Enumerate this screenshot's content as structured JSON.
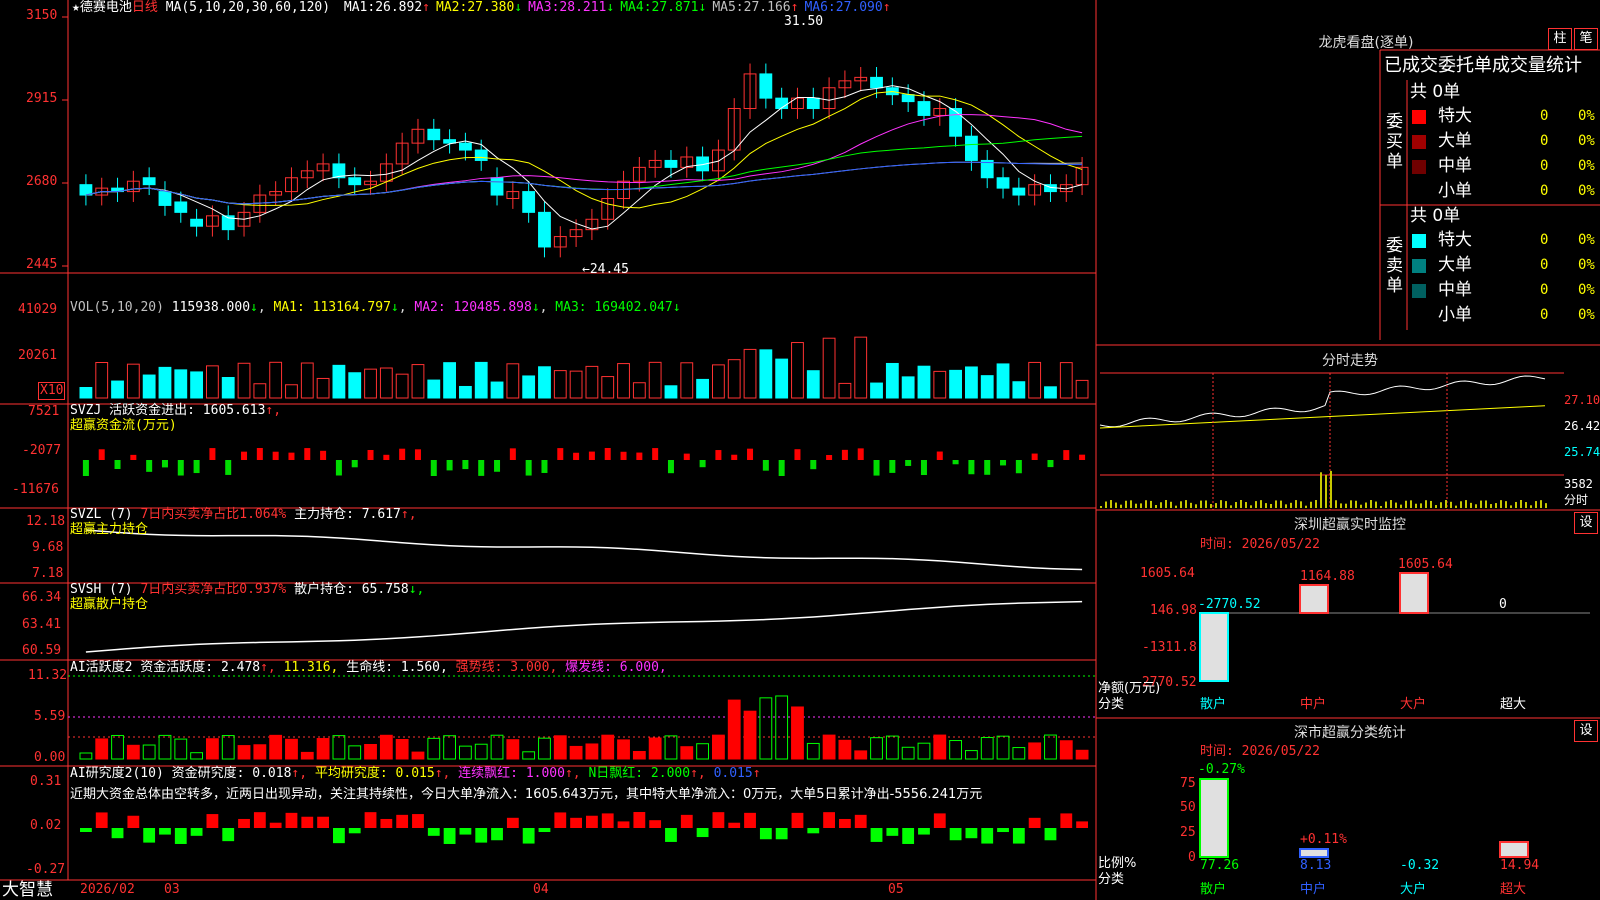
{
  "header": {
    "star": "★",
    "stock": "德赛电池",
    "period": "日线",
    "ma_label": "MA(5,10,20,30,60,120)",
    "ma": [
      {
        "name": "MA1:",
        "value": "26.892",
        "arrow": "↑",
        "color": "#ffffff"
      },
      {
        "name": "MA2:",
        "value": "27.380",
        "arrow": "↓",
        "color": "#ffff00"
      },
      {
        "name": "MA3:",
        "value": "28.211",
        "arrow": "↓",
        "color": "#ff33ff"
      },
      {
        "name": "MA4:",
        "value": "27.871",
        "arrow": "↓",
        "color": "#00ff00"
      },
      {
        "name": "MA5:",
        "value": "27.166",
        "arrow": "↑",
        "color": "#c0c0c0"
      },
      {
        "name": "MA6:",
        "value": "27.090",
        "arrow": "↑",
        "color": "#3060ff"
      }
    ]
  },
  "price_axis": [
    "3150",
    "2915",
    "2680",
    "2445"
  ],
  "annotations": {
    "high": "31.50",
    "low": "←24.45"
  },
  "vol": {
    "label": "VOL(5,10,20)",
    "value": "115938.000",
    "arrow": "↓",
    "ma1": "MA1: 113164.797",
    "ma1_arrow": "↓",
    "ma2": "MA2: 120485.898",
    "ma2_arrow": "↓",
    "ma3": "MA3: 169402.047",
    "ma3_arrow": "↓",
    "axis": [
      "41029",
      "20261"
    ],
    "unit": "X10"
  },
  "svzj": {
    "line1": "SVZJ  活跃资金进出: 1605.613",
    "arrow": "↑,",
    "line2": "超赢资金流(万元)",
    "axis": [
      "7521",
      "-2077",
      "-11676"
    ]
  },
  "svzl": {
    "label": "SVZL (7)",
    "part1": "7日内买卖净占比1.064%",
    "part2": "主力持仓: 7.617",
    "arrow": "↑,",
    "line2": "超赢主力持仓",
    "axis": [
      "12.18",
      "9.68",
      "7.18"
    ]
  },
  "svsh": {
    "label": "SVSH (7)",
    "part1": "7日内买卖净占比0.937%",
    "part2": "散户持仓: 65.758",
    "arrow": "↓,",
    "line2": "超赢散户持仓",
    "axis": [
      "66.34",
      "63.41",
      "60.59"
    ]
  },
  "ai": {
    "label": "AI活跃度2 资金活跃度: 2.478",
    "a1": "↑,",
    "v2": "11.316,",
    "v3": "生命线: 1.560,",
    "v4": "强势线: 3.000,",
    "v5": "爆发线: 6.000,",
    "axis": [
      "11.32",
      "5.59",
      "0.00"
    ]
  },
  "ai_research": {
    "label": "AI研究度2(10) 资金研究度: 0.018",
    "a1": "↑,",
    "v2": "平均研究度: 0.015",
    "a2": "↑,",
    "v3": "连续飘红: 1.000",
    "a3": "↑,",
    "v4": "N日飘红: 2.000",
    "a4": "↑,",
    "v5": "0.015",
    "a5": "↑",
    "comment": "近期大资金总体由空转多，近两日出现异动，关注其持续性，今日大单净流入：1605.643万元，其中特大单净流入：0万元，大单5日累计净出-5556.241万元",
    "axis": [
      "0.31",
      "0.02",
      "-0.27"
    ]
  },
  "dates": [
    "2026/02",
    "03",
    "04",
    "05"
  ],
  "brand": "大智慧",
  "right": {
    "tabs": [
      "柱",
      "笔"
    ],
    "title": "龙虎看盘(逐单)",
    "subtitle": "已成交委托单成交量统计",
    "buy_side": "委买单",
    "sell_side": "委卖单",
    "buy_total": "共 0单",
    "sell_total": "共 0单",
    "buy_rows": [
      {
        "name": "特大",
        "count": "0",
        "pct": "0%",
        "color": "#ff0000"
      },
      {
        "name": "大单",
        "count": "0",
        "pct": "0%",
        "color": "#a00000"
      },
      {
        "name": "中单",
        "count": "0",
        "pct": "0%",
        "color": "#700000"
      },
      {
        "name": "小单",
        "count": "0",
        "pct": "0%",
        "color": ""
      }
    ],
    "sell_rows": [
      {
        "name": "特大",
        "count": "0",
        "pct": "0%",
        "color": "#00ffff"
      },
      {
        "name": "大单",
        "count": "0",
        "pct": "0%",
        "color": "#008080"
      },
      {
        "name": "中单",
        "count": "0",
        "pct": "0%",
        "color": "#006060"
      },
      {
        "name": "小单",
        "count": "0",
        "pct": "0%",
        "color": ""
      }
    ],
    "intraday": {
      "title": "分时走势",
      "axis": [
        "27.10",
        "26.42",
        "25.74"
      ],
      "vol": "3582",
      "vol_unit": "分时"
    },
    "monitor": {
      "title": "深圳超赢实时监控",
      "btn": "设",
      "date": "时间: 2026/05/22",
      "axis": [
        "1605.64",
        "146.98",
        "-1311.8",
        "-2770.52"
      ],
      "labels": [
        "-2770.52",
        "1164.88",
        "1605.64",
        "0"
      ],
      "ylabel": "净额(万元)",
      "xlabel": "分类",
      "cats": [
        "散户",
        "中户",
        "大户",
        "超大"
      ]
    },
    "stat": {
      "title": "深市超赢分类统计",
      "btn": "设",
      "date": "时间: 2026/05/22",
      "top": "-0.27%",
      "axis": [
        "75",
        "50",
        "25",
        "0"
      ],
      "labels": [
        "+0.11%"
      ],
      "ylabel": "比例%",
      "xlabel": "分类",
      "values": [
        "77.26",
        "8.13",
        "-0.32",
        "14.94"
      ],
      "cats": [
        "散户",
        "中户",
        "大户",
        "超大"
      ]
    }
  },
  "chart_data": {
    "type": "candlestick",
    "closes": [
      26.5,
      26.7,
      26.6,
      26.9,
      26.8,
      26.2,
      26.0,
      25.6,
      25.9,
      25.5,
      26.0,
      26.5,
      26.6,
      27.0,
      27.2,
      27.4,
      27.0,
      26.8,
      26.9,
      27.4,
      28.0,
      28.4,
      28.1,
      28.0,
      27.8,
      27.5,
      26.5,
      26.6,
      26.0,
      25.0,
      25.3,
      25.5,
      25.8,
      26.4,
      26.9,
      27.3,
      27.5,
      27.3,
      27.6,
      27.2,
      27.8,
      29.0,
      30.0,
      29.3,
      29.0,
      29.3,
      29.0,
      29.6,
      29.8,
      29.9,
      29.6,
      29.4,
      29.2,
      28.8,
      29.0,
      28.2,
      27.5,
      27.0,
      26.7,
      26.5,
      26.8,
      26.6,
      26.8,
      27.3
    ],
    "opens": [
      26.8,
      26.5,
      26.7,
      26.6,
      27.0,
      26.6,
      26.3,
      25.8,
      25.6,
      25.9,
      25.6,
      26.0,
      26.5,
      26.6,
      27.0,
      27.2,
      27.4,
      27.0,
      26.8,
      26.9,
      27.4,
      28.0,
      28.4,
      28.1,
      28.0,
      27.8,
      27.0,
      26.4,
      26.6,
      26.0,
      25.0,
      25.3,
      25.5,
      25.8,
      26.4,
      26.9,
      27.3,
      27.5,
      27.3,
      27.6,
      27.2,
      27.8,
      29.0,
      30.0,
      29.3,
      29.0,
      29.3,
      29.0,
      29.6,
      29.8,
      29.9,
      29.6,
      29.4,
      29.2,
      28.8,
      29.0,
      28.2,
      27.5,
      27.0,
      26.7,
      26.5,
      26.8,
      26.6,
      26.8
    ]
  }
}
